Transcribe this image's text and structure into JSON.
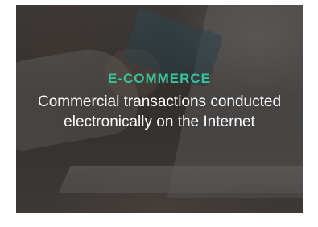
{
  "card": {
    "category": "E-COMMERCE",
    "description": "Commercial transactions conducted electronically on the Internet",
    "accent_color": "#38c39b",
    "text_color": "#ffffff"
  }
}
